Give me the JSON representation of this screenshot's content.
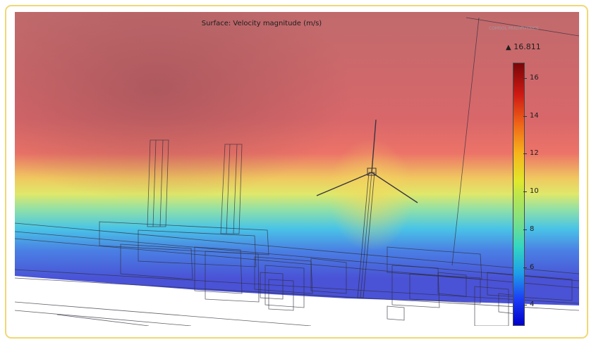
{
  "plot": {
    "title": "Surface: Velocity magnitude (m/s)",
    "max_label": "16.811",
    "max_icon": "triangle-up-icon",
    "watermark": "COMSOL MULTIPHYSICS",
    "colorbar": {
      "ticks": [
        "4",
        "6",
        "8",
        "10",
        "12",
        "14",
        "16"
      ],
      "min_value": 2.9,
      "max_value": 16.811
    }
  },
  "colors": {
    "frame_border": "#f1d873",
    "high_velocity": "#c97072",
    "low_velocity": "#4a52d6"
  }
}
